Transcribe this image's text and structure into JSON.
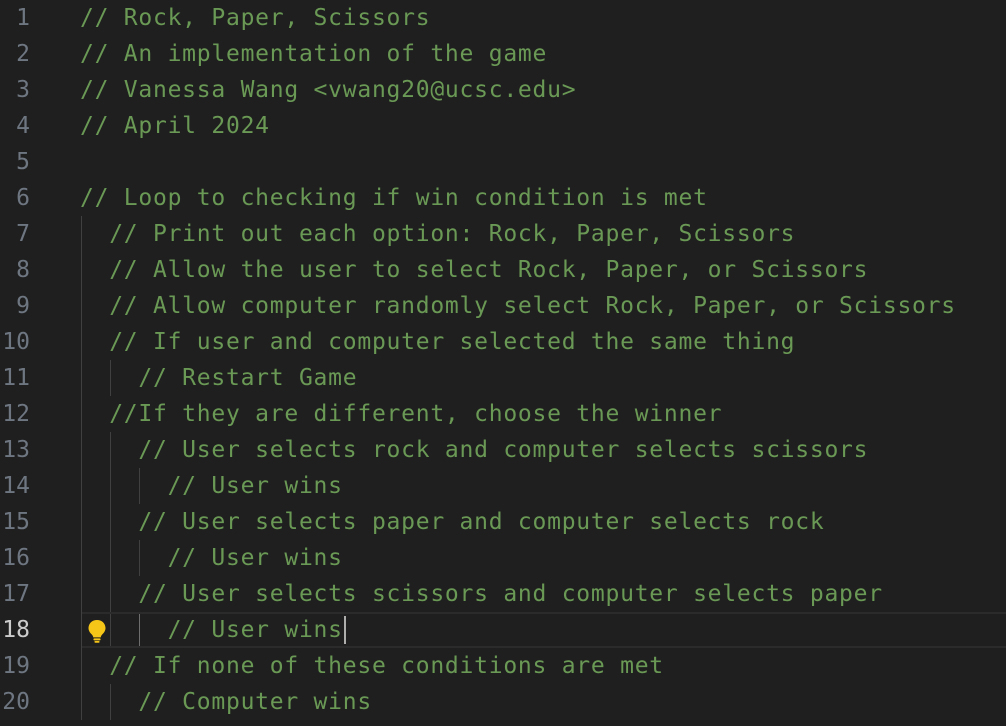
{
  "editor": {
    "current_line": 18,
    "colors": {
      "background": "#1f1f1f",
      "comment": "#6a9955",
      "line_number": "#6e7681",
      "line_number_active": "#cccccc",
      "lightbulb": "#f5c518"
    },
    "lines": [
      {
        "num": "1",
        "text": "// Rock, Paper, Scissors"
      },
      {
        "num": "2",
        "text": "// An implementation of the game"
      },
      {
        "num": "3",
        "text": "// Vanessa Wang <vwang20@ucsc.edu>"
      },
      {
        "num": "4",
        "text": "// April 2024"
      },
      {
        "num": "5",
        "text": ""
      },
      {
        "num": "6",
        "text": "// Loop to checking if win condition is met"
      },
      {
        "num": "7",
        "text": "  // Print out each option: Rock, Paper, Scissors"
      },
      {
        "num": "8",
        "text": "  // Allow the user to select Rock, Paper, or Scissors"
      },
      {
        "num": "9",
        "text": "  // Allow computer randomly select Rock, Paper, or Scissors"
      },
      {
        "num": "10",
        "text": "  // If user and computer selected the same thing"
      },
      {
        "num": "11",
        "text": "    // Restart Game"
      },
      {
        "num": "12",
        "text": "  //If they are different, choose the winner"
      },
      {
        "num": "13",
        "text": "    // User selects rock and computer selects scissors"
      },
      {
        "num": "14",
        "text": "      // User wins"
      },
      {
        "num": "15",
        "text": "    // User selects paper and computer selects rock"
      },
      {
        "num": "16",
        "text": "      // User wins"
      },
      {
        "num": "17",
        "text": "    // User selects scissors and computer selects paper"
      },
      {
        "num": "18",
        "text": "      // User wins"
      },
      {
        "num": "19",
        "text": "  // If none of these conditions are met"
      },
      {
        "num": "20",
        "text": "    // Computer wins"
      }
    ]
  }
}
